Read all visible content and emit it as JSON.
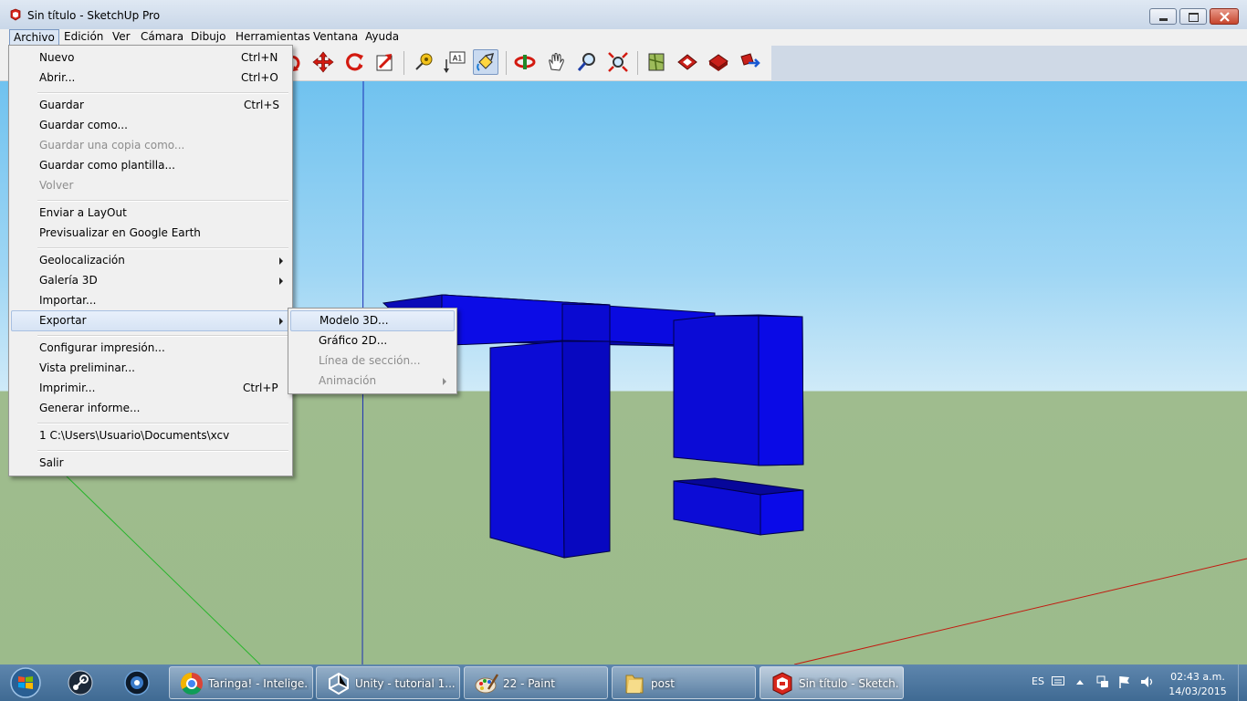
{
  "window": {
    "title": "Sin título - SketchUp Pro"
  },
  "menubar": {
    "items": [
      {
        "label": "Archivo"
      },
      {
        "label": "Edición"
      },
      {
        "label": "Ver"
      },
      {
        "label": "Cámara"
      },
      {
        "label": "Dibujo"
      },
      {
        "label": "Herramientas"
      },
      {
        "label": "Ventana"
      },
      {
        "label": "Ayuda"
      }
    ]
  },
  "toolbar": {
    "text_tool_label": "A1",
    "icons": [
      "rotate-icon",
      "move-icon",
      "follow-me-icon",
      "offset-icon",
      "tape-measure-icon",
      "text-icon",
      "paint-bucket-icon",
      "orbit-icon",
      "pan-icon",
      "zoom-icon",
      "zoom-extents-icon",
      "previous-view-icon",
      "warehouse-icon",
      "share-model-icon",
      "extension-icon"
    ]
  },
  "file_menu": {
    "items": [
      {
        "label": "Nuevo",
        "shortcut": "Ctrl+N"
      },
      {
        "label": "Abrir...",
        "shortcut": "Ctrl+O"
      },
      {
        "label": "Guardar",
        "shortcut": "Ctrl+S"
      },
      {
        "label": "Guardar como...",
        "shortcut": ""
      },
      {
        "label": "Guardar una copia como...",
        "shortcut": "",
        "disabled": true
      },
      {
        "label": "Guardar como plantilla...",
        "shortcut": ""
      },
      {
        "label": "Volver",
        "shortcut": "",
        "disabled": true
      },
      {
        "label": "Enviar a LayOut",
        "shortcut": ""
      },
      {
        "label": "Previsualizar en Google Earth",
        "shortcut": ""
      },
      {
        "label": "Geolocalización",
        "shortcut": "",
        "submenu": true
      },
      {
        "label": "Galería 3D",
        "shortcut": "",
        "submenu": true
      },
      {
        "label": "Importar...",
        "shortcut": ""
      },
      {
        "label": "Exportar",
        "shortcut": "",
        "submenu": true,
        "highlighted": true
      },
      {
        "label": "Configurar impresión...",
        "shortcut": ""
      },
      {
        "label": "Vista preliminar...",
        "shortcut": ""
      },
      {
        "label": "Imprimir...",
        "shortcut": "Ctrl+P"
      },
      {
        "label": "Generar informe...",
        "shortcut": ""
      },
      {
        "label": "1 C:\\Users\\Usuario\\Documents\\xcv",
        "shortcut": ""
      },
      {
        "label": "Salir",
        "shortcut": ""
      }
    ]
  },
  "export_submenu": {
    "items": [
      {
        "label": "Modelo 3D...",
        "highlighted": true
      },
      {
        "label": "Gráfico 2D..."
      },
      {
        "label": "Línea de sección...",
        "disabled": true
      },
      {
        "label": "Animación",
        "disabled": true,
        "submenu": true
      }
    ]
  },
  "taskbar": {
    "tasks": [
      {
        "label": "Taringa! - Intelige..."
      },
      {
        "label": "Unity - tutorial 1...."
      },
      {
        "label": "22 - Paint"
      },
      {
        "label": "post"
      },
      {
        "label": "Sin título - Sketch...",
        "active": true
      }
    ],
    "language": "ES",
    "time": "02:43 a.m.",
    "date": "14/03/2015"
  },
  "colors": {
    "model_blue": "#0a0adc",
    "sky_top": "#70c2ef",
    "ground": "#9cbb8b",
    "menu_highlight": "#d6e3f4"
  }
}
